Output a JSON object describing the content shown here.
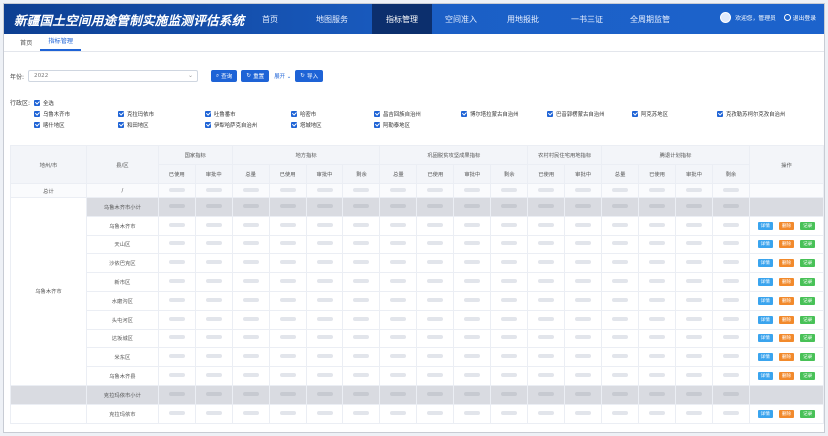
{
  "app": {
    "title": "新疆国土空间用途管制实施监测评估系统"
  },
  "nav": [
    {
      "label": "首页",
      "active": false
    },
    {
      "label": "地图服务",
      "active": false
    },
    {
      "label": "指标管理",
      "active": true
    },
    {
      "label": "空间准入",
      "active": false
    },
    {
      "label": "用地报批",
      "active": false
    },
    {
      "label": "一书三证",
      "active": false
    },
    {
      "label": "全周期监管",
      "active": false
    }
  ],
  "user": {
    "greeting": "欢迎您，管理员",
    "logout": "退出登录"
  },
  "tabs": [
    {
      "label": "首页",
      "active": false
    },
    {
      "label": "指标管理",
      "active": true
    }
  ],
  "filter": {
    "year_label": "年份:",
    "year_value": "2022",
    "query_label": "查询",
    "reset_label": "重置",
    "expand_label": "展开",
    "import_label": "导入"
  },
  "region": {
    "label": "行政区:",
    "all_label": "全选",
    "row1": [
      "乌鲁木齐市",
      "克拉玛依市",
      "吐鲁番市",
      "哈密市",
      "昌吉回族自治州",
      "博尔塔拉蒙古自治州",
      "巴音郭楞蒙古自治州",
      "阿克苏地区",
      "克孜勒苏柯尔克孜自治州"
    ],
    "row2": [
      "喀什地区",
      "和田地区",
      "伊犁哈萨克自治州",
      "塔城地区",
      "阿勒泰地区"
    ]
  },
  "table": {
    "col_city": "地州/市",
    "col_district": "县/区",
    "groups": [
      "国家指标",
      "地方指标",
      "巩固脱贫攻坚成果指标",
      "农村村民住宅用地指标",
      "腾退计划指标"
    ],
    "sub_national": [
      "已使用",
      "审批中"
    ],
    "sub_local": [
      "总量",
      "已使用",
      "审批中",
      "剩余"
    ],
    "sub_consolidate": [
      "总量",
      "已使用",
      "审批中",
      "剩余"
    ],
    "sub_rural": [
      "已使用",
      "审批中"
    ],
    "sub_retreat": [
      "总量",
      "已使用",
      "审批中",
      "剩余"
    ],
    "col_ops": "操作",
    "total_label": "总计",
    "total_district": "/",
    "city1": "乌鲁木齐市",
    "rows": [
      {
        "name": "乌鲁木齐市小计",
        "type": "sub"
      },
      {
        "name": "乌鲁木齐市",
        "type": "row"
      },
      {
        "name": "天山区",
        "type": "row"
      },
      {
        "name": "沙依巴克区",
        "type": "row"
      },
      {
        "name": "新市区",
        "type": "row"
      },
      {
        "name": "水磨沟区",
        "type": "row"
      },
      {
        "name": "头屯河区",
        "type": "row"
      },
      {
        "name": "达坂城区",
        "type": "row"
      },
      {
        "name": "米东区",
        "type": "row"
      },
      {
        "name": "乌鲁木齐县",
        "type": "row"
      },
      {
        "name": "克拉玛依市小计",
        "type": "sub"
      },
      {
        "name": "克拉玛依市",
        "type": "row"
      }
    ],
    "op_detail": "详情",
    "op_delete": "删除",
    "op_record": "记录"
  },
  "colors": {
    "brand": "#1b5fc6",
    "active_nav": "#0c2f6d",
    "detail": "#3aa4ee",
    "delete": "#f28a2c",
    "record": "#48c157"
  }
}
